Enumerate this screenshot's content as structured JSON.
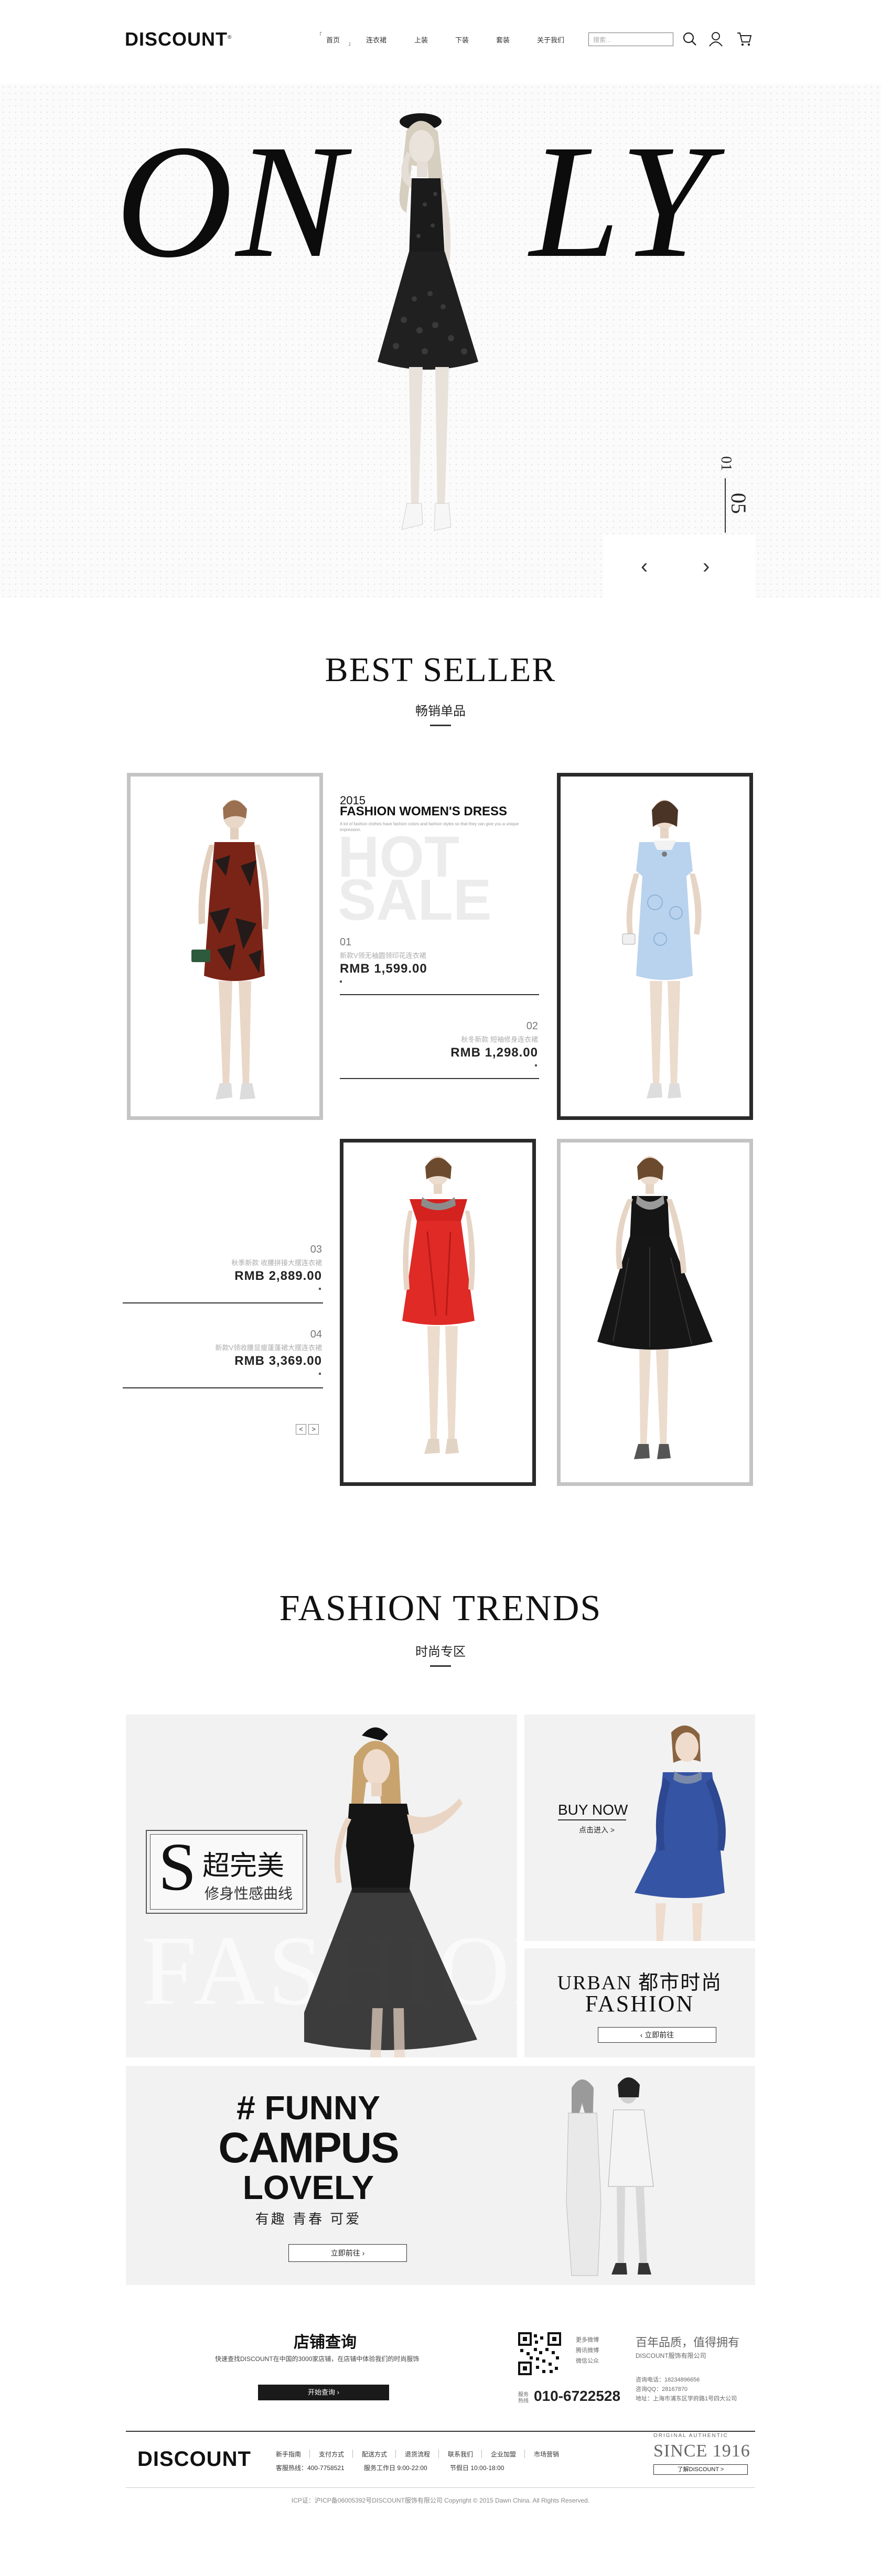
{
  "header": {
    "logo": "DISCOUNT",
    "logo_mark": "®",
    "nav": [
      "首页",
      "连衣裙",
      "上装",
      "下装",
      "套装",
      "关于我们"
    ],
    "search_placeholder": "搜索..."
  },
  "hero": {
    "headline_left": "ON",
    "headline_right": "LY",
    "current": "01",
    "total": "05",
    "prev": "‹",
    "next": "›"
  },
  "best_seller": {
    "title": "BEST SELLER",
    "subtitle": "畅销单品",
    "feature": {
      "year": "2015",
      "headline": "FASHION WOMEN'S DRESS",
      "blurb": "A lot of fashion clothes have fashion colors and fashion styles so that they can give you a unique impression.",
      "big1": "HOT",
      "big2": "SALE"
    },
    "products": [
      {
        "num": "01",
        "desc": "新款V领无袖圆领印花连衣裙",
        "price": "RMB 1,599.00"
      },
      {
        "num": "02",
        "desc": "秋冬新款 短袖修身连衣裙",
        "price": "RMB 1,298.00"
      },
      {
        "num": "03",
        "desc": "秋季新款 收腰拼接大摆连衣裙",
        "price": "RMB 2,889.00"
      },
      {
        "num": "04",
        "desc": "新款V领收腰显瘦蓬蓬裙大摆连衣裙",
        "price": "RMB 3,369.00"
      }
    ],
    "pager_prev": "<",
    "pager_next": ">"
  },
  "trends": {
    "title": "FASHION TRENDS",
    "subtitle": "时尚专区",
    "promo_letter": "S",
    "promo_line1": "超完美",
    "promo_line2": "修身性感曲线",
    "bg_word": "FASHION",
    "buy_now": "BUY NOW",
    "buy_now_sub": "点击进入 >",
    "urban_line1": "URBAN 都市时尚",
    "urban_line2": "FASHION",
    "urban_btn": "立即前往",
    "campus_line1": "# FUNNY",
    "campus_line2": "CAMPUS",
    "campus_line3": "LOVELY",
    "campus_sub": "有趣 青春 可爱",
    "campus_btn": "立即前往"
  },
  "store": {
    "title": "店铺查询",
    "desc": "快速查找DISCOUNT在中国的3000家店铺，在店铺中体验我们的时尚服饰",
    "btn": "开始查询",
    "qr_lines": [
      "更多微博",
      "腾讯微博",
      "微信公众"
    ],
    "hotline_label": "服务热线",
    "hotline": "010-6722528",
    "slogan": "百年品质，值得拥有",
    "company": "DISCOUNT服饰有限公司",
    "contact": [
      "咨询电话：18234896656",
      "咨询QQ：28167870",
      "地址：上海市浦东区学府路1号四大公司"
    ]
  },
  "footer": {
    "logo": "DISCOUNT",
    "links_row1": [
      "新手指南",
      "支付方式",
      "配送方式",
      "退货流程",
      "联系我们",
      "企业加盟",
      "市场营销"
    ],
    "links_row2": [
      "客服热线：400-7758521",
      "服务工作日 9:00-22:00",
      "节假日 10:00-18:00"
    ],
    "since_top": "ORIGINAL AUTHENTIC",
    "since": "SINCE 1916",
    "since_btn": "了解DISCOUNT >",
    "copyright": "ICP证：沪ICP备06005392号DISCOUNT服饰有限公司 Copyright © 2015 Dawn China. All Rights Reserved."
  }
}
